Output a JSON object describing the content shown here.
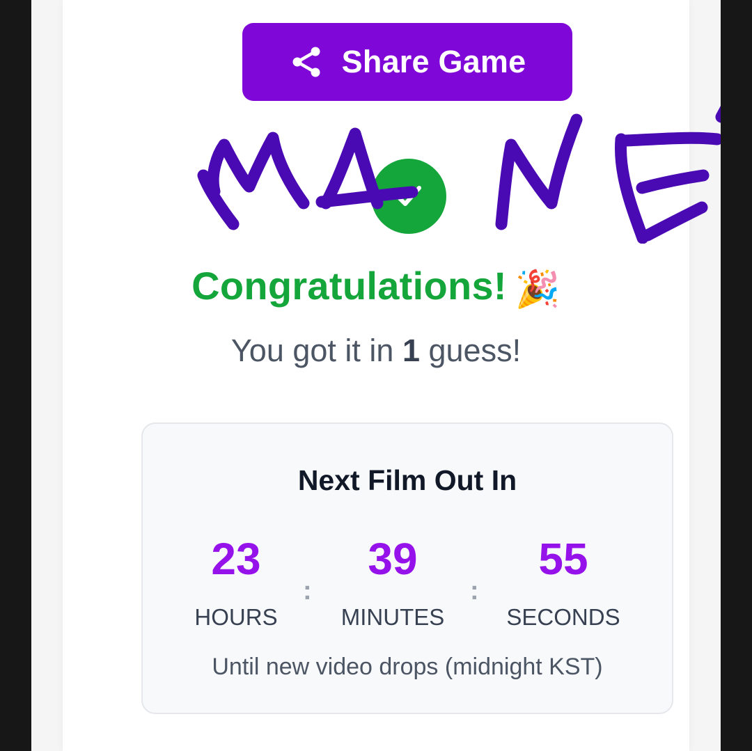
{
  "share_button": {
    "label": "Share Game",
    "icon": "share-icon"
  },
  "result": {
    "status_icon": "check-icon",
    "handwritten_annotation": "MANE",
    "congrats_text": "Congratulations!",
    "congrats_emoji": "🎉",
    "guess_prefix": "You got it in ",
    "guess_count": "1",
    "guess_suffix": " guess!"
  },
  "countdown": {
    "title": "Next Film Out In",
    "hours": "23",
    "hours_label": "HOURS",
    "minutes": "39",
    "minutes_label": "MINUTES",
    "seconds": "55",
    "seconds_label": "SECONDS",
    "separator": ":",
    "note": "Until new video drops (midnight KST)"
  },
  "colors": {
    "share_button_bg": "#7f08d8",
    "success_green": "#14a63a",
    "countdown_purple": "#9512ea",
    "scribble_ink": "#4a0ab3"
  }
}
